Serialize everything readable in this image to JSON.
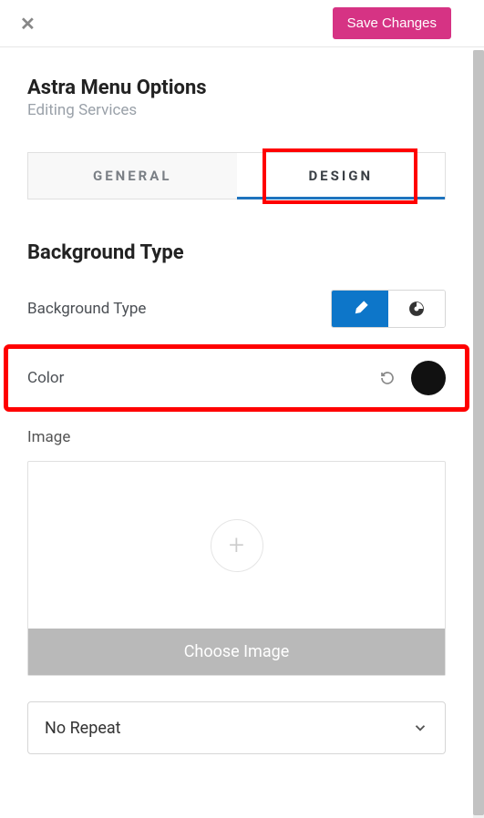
{
  "header": {
    "save_label": "Save Changes"
  },
  "panel": {
    "title": "Astra Menu Options",
    "subtitle": "Editing Services"
  },
  "tabs": {
    "general": "General",
    "design": "Design",
    "active": "design"
  },
  "section": {
    "title": "Background Type",
    "background_type_label": "Background Type",
    "color_label": "Color",
    "image_label": "Image",
    "choose_image_label": "Choose Image",
    "repeat_select_value": "No Repeat"
  },
  "bg_toggle": {
    "brush_icon": "brush-icon",
    "palette_icon": "palette-icon",
    "active": "brush"
  },
  "color": {
    "value": "#111111"
  }
}
